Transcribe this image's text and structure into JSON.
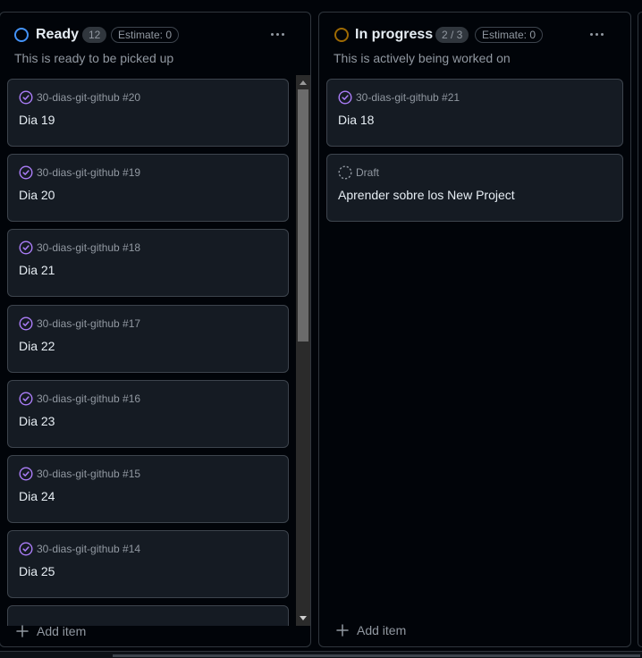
{
  "columns": [
    {
      "id": "ready",
      "title": "Ready",
      "status_color": "#4493f8",
      "count": "12",
      "estimate": "Estimate: 0",
      "description": "This is ready to be picked up",
      "add_item_label": "Add item",
      "scroll_position": 0.0,
      "cards": [
        {
          "ref": "30-dias-git-github #20",
          "title": "Dia 19",
          "type": "issue-closed"
        },
        {
          "ref": "30-dias-git-github #19",
          "title": "Dia 20",
          "type": "issue-closed"
        },
        {
          "ref": "30-dias-git-github #18",
          "title": "Dia 21",
          "type": "issue-closed"
        },
        {
          "ref": "30-dias-git-github #17",
          "title": "Dia 22",
          "type": "issue-closed"
        },
        {
          "ref": "30-dias-git-github #16",
          "title": "Dia 23",
          "type": "issue-closed"
        },
        {
          "ref": "30-dias-git-github #15",
          "title": "Dia 24",
          "type": "issue-closed"
        },
        {
          "ref": "30-dias-git-github #14",
          "title": "Dia 25",
          "type": "issue-closed"
        }
      ]
    },
    {
      "id": "in-progress",
      "title": "In progress",
      "status_color": "#9e6a03",
      "count": "2 / 3",
      "estimate": "Estimate: 0",
      "description": "This is actively being worked on",
      "add_item_label": "Add item",
      "cards": [
        {
          "ref": "30-dias-git-github #21",
          "title": "Dia 18",
          "type": "issue-closed"
        },
        {
          "ref": "Draft",
          "title": "Aprender sobre los New Project",
          "type": "draft"
        }
      ]
    }
  ],
  "icons": {
    "issue_closed": "check-circle-icon",
    "draft": "draft-circle-icon",
    "more": "kebab-horizontal-icon",
    "add": "plus-icon"
  },
  "colors": {
    "done_purple": "#ab7df8",
    "draft_gray": "#9198a1"
  }
}
